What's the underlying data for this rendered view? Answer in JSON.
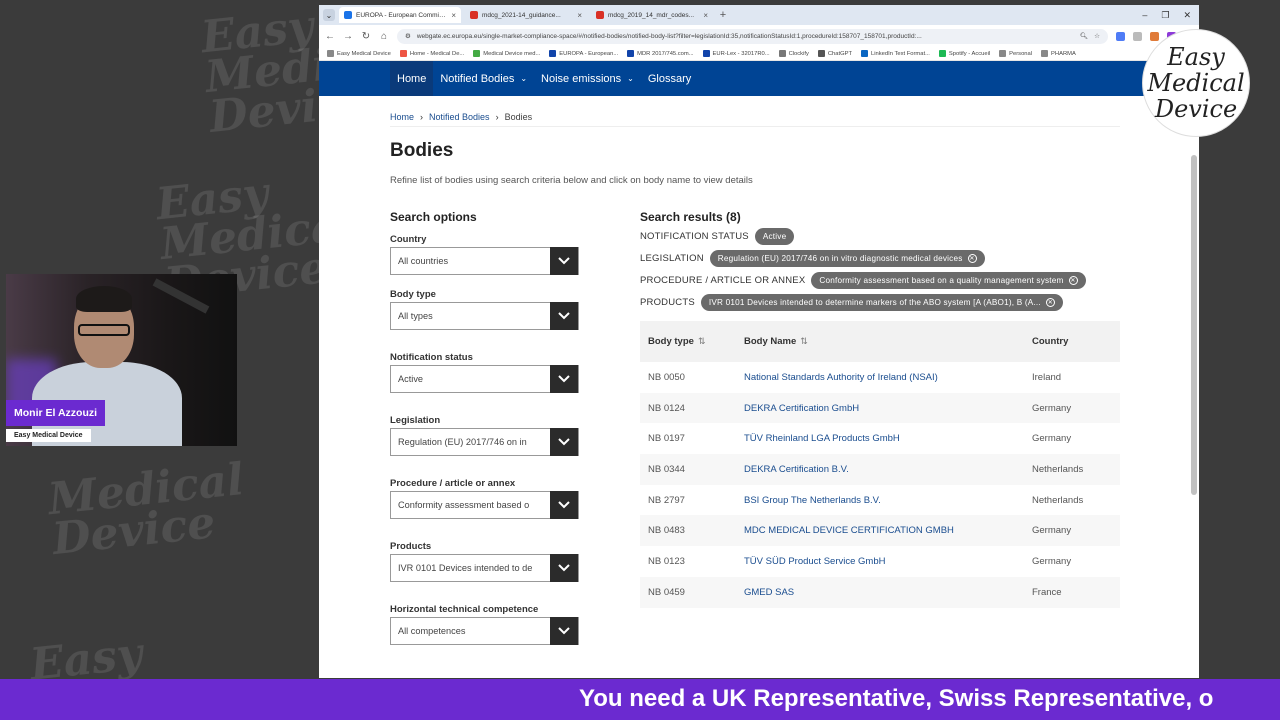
{
  "browser": {
    "tabs": [
      {
        "title": "EUROPA - European Commission",
        "active": true,
        "color": "#1a73e8"
      },
      {
        "title": "mdcg_2021-14_guidance...",
        "active": false,
        "color": "#d93025"
      },
      {
        "title": "mdcg_2019_14_mdr_codes...",
        "active": false,
        "color": "#d93025"
      }
    ],
    "url": "webgate.ec.europa.eu/single-market-compliance-space/#/notified-bodies/notified-body-list?filter=legislationId:35,notificationStatusId:1,procedureId:158707_158701,productId:...",
    "bookmarks": [
      "Easy Medical Device",
      "Home - Medical De...",
      "Medical Device med...",
      "EUROPA - European...",
      "MDR 2017/745.com...",
      "EUR-Lex - 32017R0...",
      "Clockify",
      "ChatGPT",
      "LinkedIn Text Format...",
      "Spotify - Accueil",
      "Personal",
      "PHARMA"
    ]
  },
  "nav": {
    "home": "Home",
    "notified_bodies": "Notified Bodies",
    "noise": "Noise emissions",
    "glossary": "Glossary"
  },
  "breadcrumb": {
    "home": "Home",
    "nb": "Notified Bodies",
    "current": "Bodies"
  },
  "page": {
    "title": "Bodies",
    "intro": "Refine list of bodies using search criteria below and click on body name to view details"
  },
  "search_options": {
    "heading": "Search options",
    "fields": [
      {
        "label": "Country",
        "value": "All countries"
      },
      {
        "label": "Body type",
        "value": "All types"
      },
      {
        "label": "Notification status",
        "value": "Active"
      },
      {
        "label": "Legislation",
        "value": "Regulation (EU) 2017/746 on in"
      },
      {
        "label": "Procedure / article or annex",
        "value": "Conformity assessment based o"
      },
      {
        "label": "Products",
        "value": "IVR 0101 Devices intended to de"
      },
      {
        "label": "Horizontal technical competence",
        "value": "All competences"
      }
    ]
  },
  "results": {
    "heading": "Search results (8)",
    "filters": [
      {
        "label": "NOTIFICATION STATUS",
        "chip": "Active",
        "removable": false
      },
      {
        "label": "LEGISLATION",
        "chip": "Regulation (EU) 2017/746 on in vitro diagnostic medical devices",
        "removable": true
      },
      {
        "label": "PROCEDURE / ARTICLE OR ANNEX",
        "chip": "Conformity assessment based on a quality management system",
        "removable": true
      },
      {
        "label": "PRODUCTS",
        "chip": "IVR 0101 Devices intended to determine markers of the ABO system [A (ABO1), B (A...",
        "removable": true
      }
    ],
    "columns": {
      "body_type": "Body type",
      "body_name": "Body Name",
      "country": "Country"
    },
    "rows": [
      {
        "type": "NB 0050",
        "name": "National Standards Authority of Ireland (NSAI)",
        "country": "Ireland"
      },
      {
        "type": "NB 0124",
        "name": "DEKRA Certification GmbH",
        "country": "Germany"
      },
      {
        "type": "NB 0197",
        "name": "TÜV Rheinland LGA Products GmbH",
        "country": "Germany"
      },
      {
        "type": "NB 0344",
        "name": "DEKRA Certification B.V.",
        "country": "Netherlands"
      },
      {
        "type": "NB 2797",
        "name": "BSI Group The Netherlands B.V.",
        "country": "Netherlands"
      },
      {
        "type": "NB 0483",
        "name": "MDC MEDICAL DEVICE CERTIFICATION GMBH",
        "country": "Germany"
      },
      {
        "type": "NB 0123",
        "name": "TÜV SÜD Product Service GmbH",
        "country": "Germany"
      },
      {
        "type": "NB 0459",
        "name": "GMED SAS",
        "country": "France"
      }
    ]
  },
  "overlay": {
    "logo_lines": [
      "Easy",
      "Medical",
      "Device"
    ],
    "presenter_name": "Monir El Azzouzi",
    "presenter_org": "Easy Medical Device",
    "ticker": "You need a UK Representative, Swiss Representative, o"
  }
}
